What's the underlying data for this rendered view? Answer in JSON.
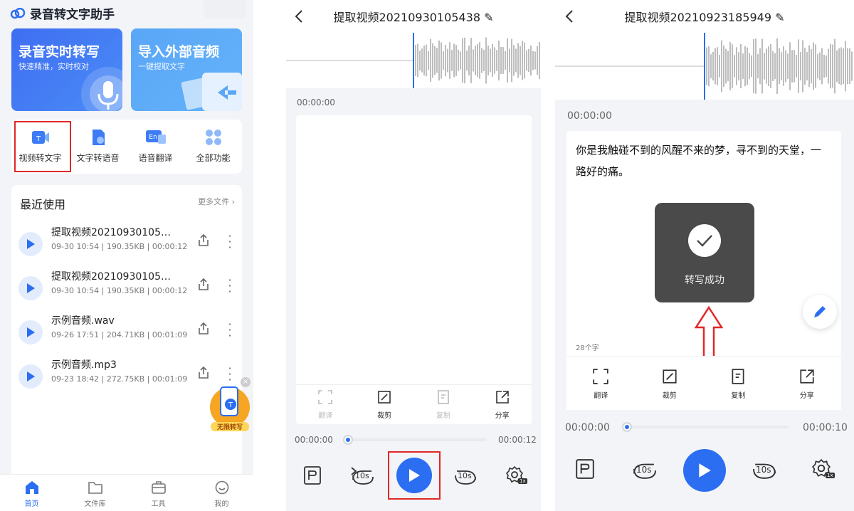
{
  "home": {
    "app_title": "录音转文字助手",
    "card_record": {
      "title": "录音实时转写",
      "subtitle": "快速精准，实时校对"
    },
    "card_import": {
      "title": "导入外部音频",
      "subtitle": "一键提取文字"
    },
    "quick_actions": [
      {
        "label": "视频转文字",
        "icon": "video-text-icon"
      },
      {
        "label": "文字转语音",
        "icon": "text-speech-icon"
      },
      {
        "label": "语音翻译",
        "icon": "translate-icon"
      },
      {
        "label": "全部功能",
        "icon": "grid-icon"
      }
    ],
    "recent_title": "最近使用",
    "more_files": "更多文件",
    "files": [
      {
        "name": "提取视频20210930105…",
        "date": "09-30 10:54",
        "size": "190.35KB",
        "duration": "00:00:12"
      },
      {
        "name": "提取视频20210930105…",
        "date": "09-30 10:54",
        "size": "190.35KB",
        "duration": "00:00:12"
      },
      {
        "name": "示例音频.wav",
        "date": "09-26 17:51",
        "size": "204.71KB",
        "duration": "00:01:09"
      },
      {
        "name": "示例音频.mp3",
        "date": "09-23 18:42",
        "size": "272.75KB",
        "duration": "00:01:09"
      }
    ],
    "promo_label": "无限转写",
    "tabs": [
      {
        "label": "首页",
        "active": true
      },
      {
        "label": "文件库",
        "active": false
      },
      {
        "label": "工具",
        "active": false
      },
      {
        "label": "我的",
        "active": false
      }
    ]
  },
  "player1": {
    "title": "提取视频20210930105438",
    "timestamp": "00:00:00",
    "tools": [
      {
        "label": "翻译",
        "enabled": false
      },
      {
        "label": "裁剪",
        "enabled": true
      },
      {
        "label": "复制",
        "enabled": false
      },
      {
        "label": "分享",
        "enabled": true
      }
    ],
    "current": "00:00:00",
    "total": "00:00:12",
    "skip_back": "10s",
    "skip_fwd": "10s",
    "speed": "1x"
  },
  "player2": {
    "title": "提取视频20210923185949",
    "timestamp": "00:00:00",
    "transcript": "你是我触碰不到的风醒不来的梦，寻不到的天堂，一路好的痛。",
    "char_count": "28个字",
    "toast": "转写成功",
    "tools": [
      {
        "label": "翻译",
        "enabled": true
      },
      {
        "label": "裁剪",
        "enabled": true
      },
      {
        "label": "复制",
        "enabled": true
      },
      {
        "label": "分享",
        "enabled": true
      }
    ],
    "current": "00:00:00",
    "total": "00:00:10",
    "skip_back": "10s",
    "skip_fwd": "10s",
    "speed": "1x"
  },
  "colors": {
    "accent": "#2b6ef2",
    "highlight": "#e02828"
  }
}
